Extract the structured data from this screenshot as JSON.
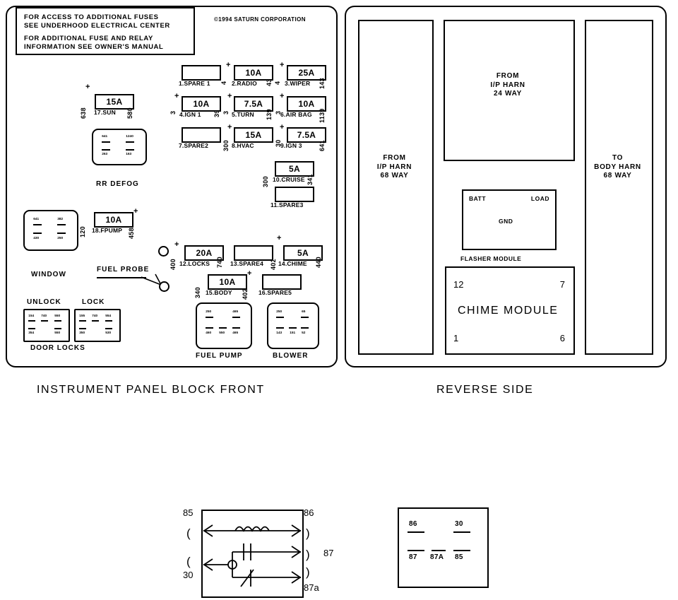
{
  "notice": {
    "line1": "FOR ACCESS TO ADDITIONAL FUSES",
    "line2": "SEE UNDERHOOD ELECTRICAL CENTER",
    "line3": "FOR ADDITIONAL FUSE AND RELAY",
    "line4": "INFORMATION SEE OWNER'S MANUAL"
  },
  "copyright": "©1994 SATURN CORPORATION",
  "captions": {
    "front": "INSTRUMENT PANEL BLOCK FRONT",
    "reverse": "REVERSE SIDE"
  },
  "fuses": [
    {
      "name": "1.SPARE 1",
      "rating": "",
      "left": "",
      "right": "",
      "plus": false
    },
    {
      "name": "2.RADIO",
      "rating": "10A",
      "left": "4",
      "right": "43",
      "plus": true
    },
    {
      "name": "3.WIPER",
      "rating": "25A",
      "left": "4",
      "right": "143",
      "plus": true
    },
    {
      "name": "4.IGN 1",
      "rating": "10A",
      "left": "3",
      "right": "39",
      "plus": true
    },
    {
      "name": "5.TURN",
      "rating": "7.5A",
      "left": "3",
      "right": "139",
      "plus": true
    },
    {
      "name": "6.AIR BAG",
      "rating": "10A",
      "left": "3",
      "right": "1139",
      "plus": true
    },
    {
      "name": "7.SPARE2",
      "rating": "",
      "left": "",
      "right": "",
      "plus": false
    },
    {
      "name": "8.HVAC",
      "rating": "15A",
      "left": "300",
      "right": "",
      "plus": true
    },
    {
      "name": "9.IGN 3",
      "rating": "7.5A",
      "left": "30",
      "right": "641",
      "plus": true
    },
    {
      "name": "10.CRUISE",
      "rating": "5A",
      "left": "300",
      "right": "341",
      "plus": false
    },
    {
      "name": "11.SPARE3",
      "rating": "",
      "left": "",
      "right": "",
      "plus": false
    },
    {
      "name": "12.LOCKS",
      "rating": "20A",
      "left": "400",
      "right": "740",
      "plus": true
    },
    {
      "name": "13.SPARE4",
      "rating": "",
      "left": "",
      "right": "",
      "plus": false
    },
    {
      "name": "14.CHIME",
      "rating": "5A",
      "left": "402",
      "right": "440",
      "plus": true
    },
    {
      "name": "15.BODY",
      "rating": "10A",
      "left": "340",
      "right": "402",
      "plus": true
    },
    {
      "name": "16.SPARE5",
      "rating": "",
      "left": "",
      "right": "",
      "plus": false
    },
    {
      "name": "17.SUN",
      "rating": "15A",
      "left": "638",
      "right": "580",
      "plus": true
    },
    {
      "name": "18.FPUMP",
      "rating": "10A",
      "left": "120",
      "right": "458",
      "plus": true
    }
  ],
  "relays": [
    {
      "label": "RR DEFOG",
      "top": [
        "641",
        "1240"
      ],
      "bottom": [
        "263",
        "163"
      ]
    },
    {
      "label": "WINDOW",
      "top": [
        "641",
        "382"
      ],
      "bottom": [
        "430",
        "250"
      ]
    },
    {
      "label": "UNLOCK",
      "top": [
        "154",
        "740",
        "550"
      ],
      "bottom": [
        "354",
        "550"
      ]
    },
    {
      "label": "LOCK",
      "top": [
        "155",
        "740",
        "554"
      ],
      "bottom": [
        "350",
        "530"
      ]
    },
    {
      "label": "FUEL PUMP",
      "top": [
        "250",
        "465"
      ],
      "bottom": [
        "460",
        "550",
        "465"
      ]
    },
    {
      "label": "BLOWER",
      "top": [
        "250",
        "65"
      ],
      "bottom": [
        "143",
        "151",
        "52"
      ]
    }
  ],
  "relay_group_labels": {
    "door_locks": "DOOR LOCKS"
  },
  "fuel_probe_label": "FUEL PROBE",
  "reverse": {
    "left_connector": "FROM\nI/P HARN\n68 WAY",
    "top_connector": "FROM\nI/P HARN\n24 WAY",
    "right_connector": "TO\nBODY HARN\n68 WAY",
    "flasher": {
      "batt": "BATT",
      "load": "LOAD",
      "gnd": "GND",
      "caption": "FLASHER MODULE"
    },
    "chime": {
      "title": "CHIME MODULE",
      "top_left": "12",
      "top_right": "7",
      "bottom_left": "1",
      "bottom_right": "6"
    }
  },
  "schematic": {
    "terminal_85": "85",
    "terminal_86": "86",
    "terminal_30": "30",
    "terminal_87": "87",
    "terminal_87a": "87a",
    "paren_open": "(",
    "paren_close": ")"
  },
  "pinout": {
    "p86": "86",
    "p30": "30",
    "p87": "87",
    "p87a": "87A",
    "p85": "85"
  }
}
